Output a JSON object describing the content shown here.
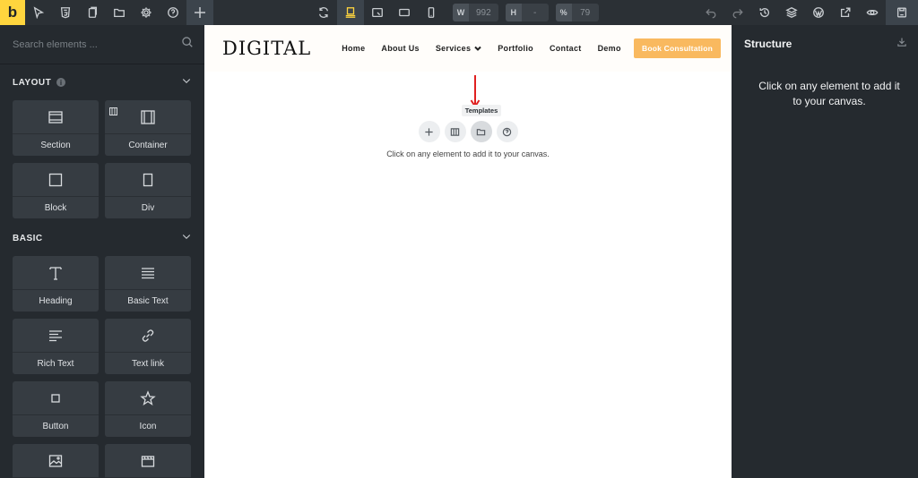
{
  "toolbar": {
    "logo": "b",
    "left_icons": [
      "cursor-icon",
      "html5-icon",
      "pages-icon",
      "folder-icon",
      "gear-icon",
      "help-icon",
      "plus-icon"
    ],
    "center_icons": [
      "refresh-icon",
      "desktop-icon",
      "tablet-landscape-icon",
      "tablet-icon",
      "mobile-icon"
    ],
    "active_breakpoint": "desktop-icon",
    "width_label": "W",
    "width_value": "992",
    "height_label": "H",
    "height_value": "-",
    "zoom_label": "%",
    "zoom_value": "79",
    "right_icons": [
      "undo-icon",
      "redo-icon",
      "history-icon",
      "layers-icon",
      "wordpress-icon",
      "external-link-icon",
      "eye-icon",
      "save-icon"
    ]
  },
  "left_panel": {
    "search_placeholder": "Search elements ...",
    "groups": [
      {
        "title": "LAYOUT",
        "items": [
          {
            "label": "Section",
            "icon": "section-icon"
          },
          {
            "label": "Container",
            "icon": "container-icon"
          },
          {
            "label": "Block",
            "icon": "block-icon"
          },
          {
            "label": "Div",
            "icon": "div-icon"
          }
        ]
      },
      {
        "title": "BASIC",
        "items": [
          {
            "label": "Heading",
            "icon": "heading-icon"
          },
          {
            "label": "Basic Text",
            "icon": "text-lines-icon"
          },
          {
            "label": "Rich Text",
            "icon": "rich-text-icon"
          },
          {
            "label": "Text link",
            "icon": "link-icon"
          },
          {
            "label": "Button",
            "icon": "button-icon"
          },
          {
            "label": "Icon",
            "icon": "star-icon"
          },
          {
            "label": "",
            "icon": "image-icon"
          },
          {
            "label": "",
            "icon": "video-icon"
          }
        ]
      }
    ]
  },
  "canvas": {
    "brand": "DIGITAL",
    "nav": [
      "Home",
      "About Us",
      "Services",
      "Portfolio",
      "Contact",
      "Demo"
    ],
    "cta": "Book Consultation",
    "tooltip": "Templates",
    "actions": [
      "plus-icon",
      "columns-icon",
      "folder-icon",
      "help-icon"
    ],
    "empty_text": "Click on any element to add it to your canvas."
  },
  "right_panel": {
    "title": "Structure",
    "message": "Click on any element to add it to your canvas."
  },
  "colors": {
    "accent": "#ffd53e",
    "cta": "#f9b95f",
    "arrow": "#e02020"
  }
}
